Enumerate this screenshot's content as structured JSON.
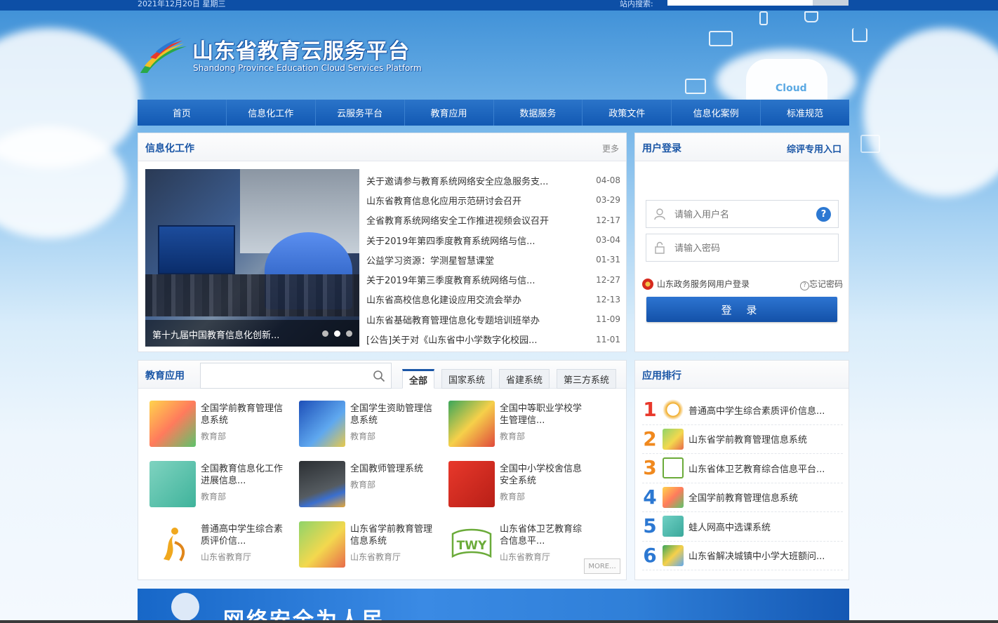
{
  "topbar": {
    "date": "2021年12月20日 星期三",
    "search_label": "站内搜索:"
  },
  "logo": {
    "title_cn": "山东省教育云服务平台",
    "title_en": "Shandong Province Education Cloud Services Platform"
  },
  "cloud_badge": "Cloud",
  "nav": [
    "首页",
    "信息化工作",
    "云服务平台",
    "教育应用",
    "数据服务",
    "政策文件",
    "信息化案例",
    "标准规范"
  ],
  "info": {
    "title": "信息化工作",
    "more": "更多",
    "slide_caption": "第十九届中国教育信息化创新...",
    "news": [
      {
        "title": "关于邀请参与教育系统网络安全应急服务支...",
        "date": "04-08"
      },
      {
        "title": "山东省教育信息化应用示范研讨会召开",
        "date": "03-29"
      },
      {
        "title": "全省教育系统网络安全工作推进视频会议召开",
        "date": "12-17"
      },
      {
        "title": "关于2019年第四季度教育系统网络与信...",
        "date": "03-04"
      },
      {
        "title": "公益学习资源：学测星智慧课堂",
        "date": "01-31"
      },
      {
        "title": "关于2019年第三季度教育系统网络与信...",
        "date": "12-27"
      },
      {
        "title": "山东省高校信息化建设应用交流会举办",
        "date": "12-13"
      },
      {
        "title": "山东省基础教育管理信息化专题培训班举办",
        "date": "11-09"
      },
      {
        "title": "[公告]关于对《山东省中小学数字化校园...",
        "date": "11-01"
      }
    ]
  },
  "login": {
    "title": "用户登录",
    "review_link": "综评专用入口",
    "username_placeholder": "请输入用户名",
    "password_placeholder": "请输入密码",
    "help": "?",
    "gov_login": "山东政务服务网用户登录",
    "forgot": "忘记密码",
    "button": "登 录"
  },
  "apps": {
    "title": "教育应用",
    "tabs": [
      "全部",
      "国家系统",
      "省建系统",
      "第三方系统"
    ],
    "more": "MORE...",
    "items": [
      {
        "name": "全国学前教育管理信息系统",
        "org": "教育部"
      },
      {
        "name": "全国学生资助管理信息系统",
        "org": "教育部"
      },
      {
        "name": "全国中等职业学校学生管理信...",
        "org": "教育部"
      },
      {
        "name": "全国教育信息化工作进展信息...",
        "org": "教育部"
      },
      {
        "name": "全国教师管理系统",
        "org": "教育部"
      },
      {
        "name": "全国中小学校舍信息安全系统",
        "org": "教育部"
      },
      {
        "name": "普通高中学生综合素质评价信...",
        "org": "山东省教育厅"
      },
      {
        "name": "山东省学前教育管理信息系统",
        "org": "山东省教育厅"
      },
      {
        "name": "山东省体卫艺教育综合信息平...",
        "org": "山东省教育厅"
      }
    ]
  },
  "rank": {
    "title": "应用排行",
    "items": [
      {
        "num": "1",
        "name": "普通高中学生综合素质评价信息..."
      },
      {
        "num": "2",
        "name": "山东省学前教育管理信息系统"
      },
      {
        "num": "3",
        "name": "山东省体卫艺教育综合信息平台..."
      },
      {
        "num": "4",
        "name": "全国学前教育管理信息系统"
      },
      {
        "num": "5",
        "name": "蛙人网高中选课系统"
      },
      {
        "num": "6",
        "name": "山东省解决城镇中小学大班额问..."
      }
    ]
  },
  "banner": "网络安全为人民",
  "colors": {
    "brand": "#1a56a6",
    "nav": "#1259b3",
    "rank_red": "#e8382b",
    "rank_orange": "#f0891e",
    "rank_blue": "#2c78d2"
  }
}
